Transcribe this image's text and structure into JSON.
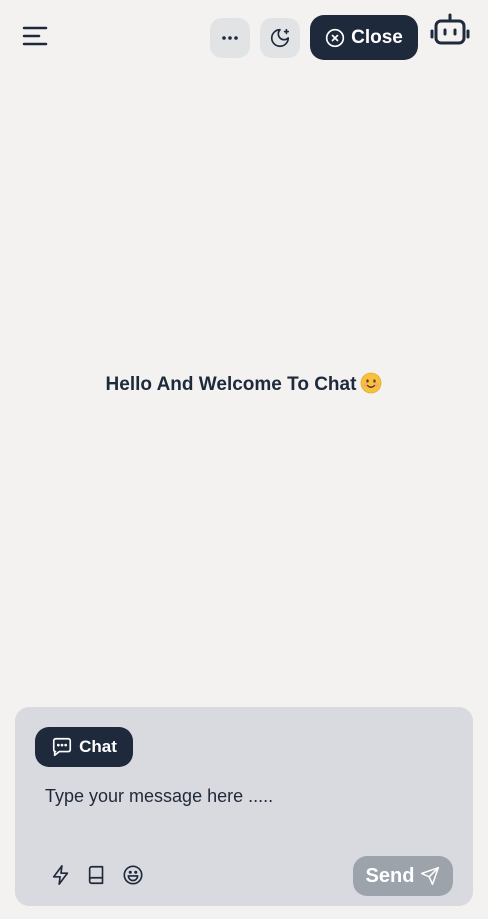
{
  "header": {
    "menu_icon": "menu-icon",
    "more_icon": "more-horizontal-icon",
    "theme_icon": "moon-sparkle-icon",
    "close_label": "Close",
    "close_icon": "close-circle-icon",
    "bot_icon": "robot-icon"
  },
  "main": {
    "welcome_text": "Hello And Welcome To Chat",
    "welcome_emoji": "smiling-face-emoji"
  },
  "composer": {
    "mode_label": "Chat",
    "mode_icon": "message-dots-icon",
    "placeholder": "Type your message here .....",
    "value": "",
    "tools": [
      "lightning-icon",
      "book-icon",
      "smile-icon"
    ],
    "send_label": "Send",
    "send_icon": "send-icon"
  },
  "colors": {
    "background": "#f3f2f1",
    "primary": "#1e293b",
    "composer_bg": "#d9dadf",
    "send_disabled": "#9ca3ab"
  }
}
